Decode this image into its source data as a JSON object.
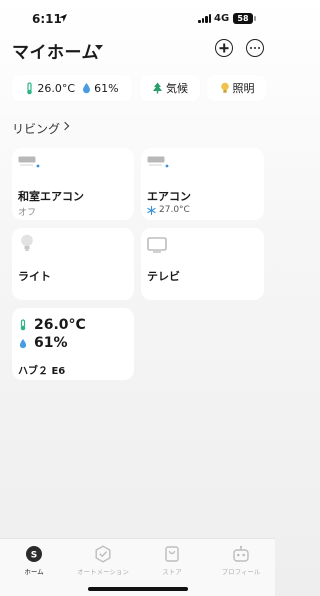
{
  "status": {
    "time": "6:11",
    "network": "4G",
    "battery": "58"
  },
  "header": {
    "title": "マイホーム"
  },
  "chips": {
    "temperature": "26.0°C",
    "humidity": "61%",
    "climate": "気候",
    "lighting": "照明"
  },
  "room": {
    "name": "リビング"
  },
  "devices": [
    {
      "name": "和室エアコン",
      "status": "オフ",
      "icon": "air-conditioner-icon"
    },
    {
      "name": "エアコン",
      "status": "27.0°C",
      "icon": "air-conditioner-icon"
    },
    {
      "name": "ライト",
      "icon": "bulb-icon"
    },
    {
      "name": "テレビ",
      "icon": "tv-icon"
    }
  ],
  "hub": {
    "name": "ハブ２ E6",
    "temperature": "26.0°C",
    "humidity": "61%"
  },
  "tabs": [
    {
      "label": "ホーム",
      "active": true
    },
    {
      "label": "オートメーション",
      "active": false
    },
    {
      "label": "ストア",
      "active": false
    },
    {
      "label": "プロフィール",
      "active": false
    }
  ],
  "colors": {
    "temp_green": "#2bb58a",
    "humidity_blue": "#4a9be0",
    "bulb_yellow": "#f0c24b",
    "tree_green": "#2a9d6e",
    "snow_blue": "#3a8fd8"
  }
}
